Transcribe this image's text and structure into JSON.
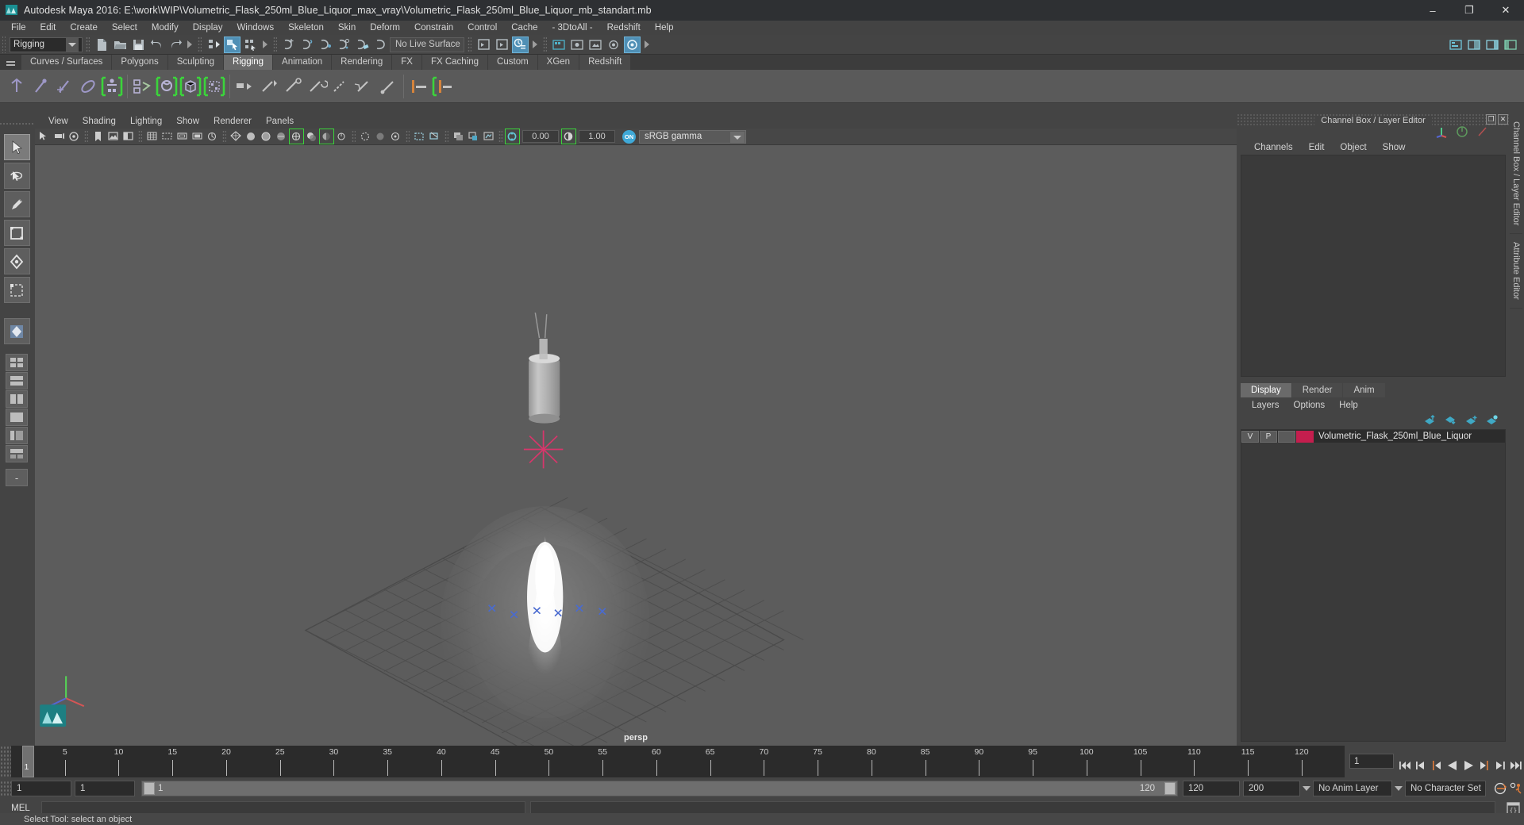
{
  "window": {
    "title": "Autodesk Maya 2016: E:\\work\\WIP\\Volumetric_Flask_250ml_Blue_Liquor_max_vray\\Volumetric_Flask_250ml_Blue_Liquor_mb_standart.mb",
    "minimize": "–",
    "maximize": "❐",
    "close": "✕"
  },
  "menubar": {
    "items": [
      "File",
      "Edit",
      "Create",
      "Select",
      "Modify",
      "Display",
      "Windows",
      "Skeleton",
      "Skin",
      "Deform",
      "Constrain",
      "Control",
      "Cache",
      "- 3DtoAll -",
      "Redshift",
      "Help"
    ]
  },
  "statusline": {
    "mode_menu": "Rigging",
    "live_surface": "No Live Surface"
  },
  "shelf": {
    "tabs": [
      "Curves / Surfaces",
      "Polygons",
      "Sculpting",
      "Rigging",
      "Animation",
      "Rendering",
      "FX",
      "FX Caching",
      "Custom",
      "XGen",
      "Redshift"
    ],
    "active_tab": "Rigging"
  },
  "viewport": {
    "menus": [
      "View",
      "Shading",
      "Lighting",
      "Show",
      "Renderer",
      "Panels"
    ],
    "exposure_value": "0.00",
    "gamma_value": "1.00",
    "color_profile": "sRGB gamma",
    "on_badge": "ON",
    "camera_label": "persp"
  },
  "channelbox": {
    "panel_title": "Channel Box / Layer Editor",
    "maximize_icon": "❐",
    "close_icon": "✕",
    "tabs": [
      "Channels",
      "Edit",
      "Object",
      "Show"
    ]
  },
  "layer_editor": {
    "tabs": [
      "Display",
      "Render",
      "Anim"
    ],
    "active_tab": "Display",
    "menus": [
      "Layers",
      "Options",
      "Help"
    ],
    "layers": [
      {
        "visibility": "V",
        "playback": "P",
        "color": "#c41e4e",
        "name": "Volumetric_Flask_250ml_Blue_Liquor"
      }
    ]
  },
  "vertical_tabs": [
    "Channel Box / Layer Editor",
    "Attribute Editor"
  ],
  "timeline": {
    "ticks": [
      5,
      10,
      15,
      20,
      25,
      30,
      35,
      40,
      45,
      50,
      55,
      60,
      65,
      70,
      75,
      80,
      85,
      90,
      95,
      100,
      105,
      110,
      115,
      120
    ],
    "current_frame": "1",
    "current_frame_field": "1",
    "range_start": "1",
    "range_start2": "1",
    "slider_label": "1",
    "slider_end_label": "120",
    "range_end": "120",
    "playback_end": "200",
    "anim_layer": "No Anim Layer",
    "character_set": "No Character Set"
  },
  "mel": {
    "label": "MEL",
    "command": ""
  },
  "statusbar": {
    "message": "Select Tool: select an object"
  },
  "colors": {
    "accent_green": "#3bd43b",
    "accent_blue": "#4f8fb5",
    "layer_red": "#c41e4e",
    "orange": "#e07b39"
  }
}
